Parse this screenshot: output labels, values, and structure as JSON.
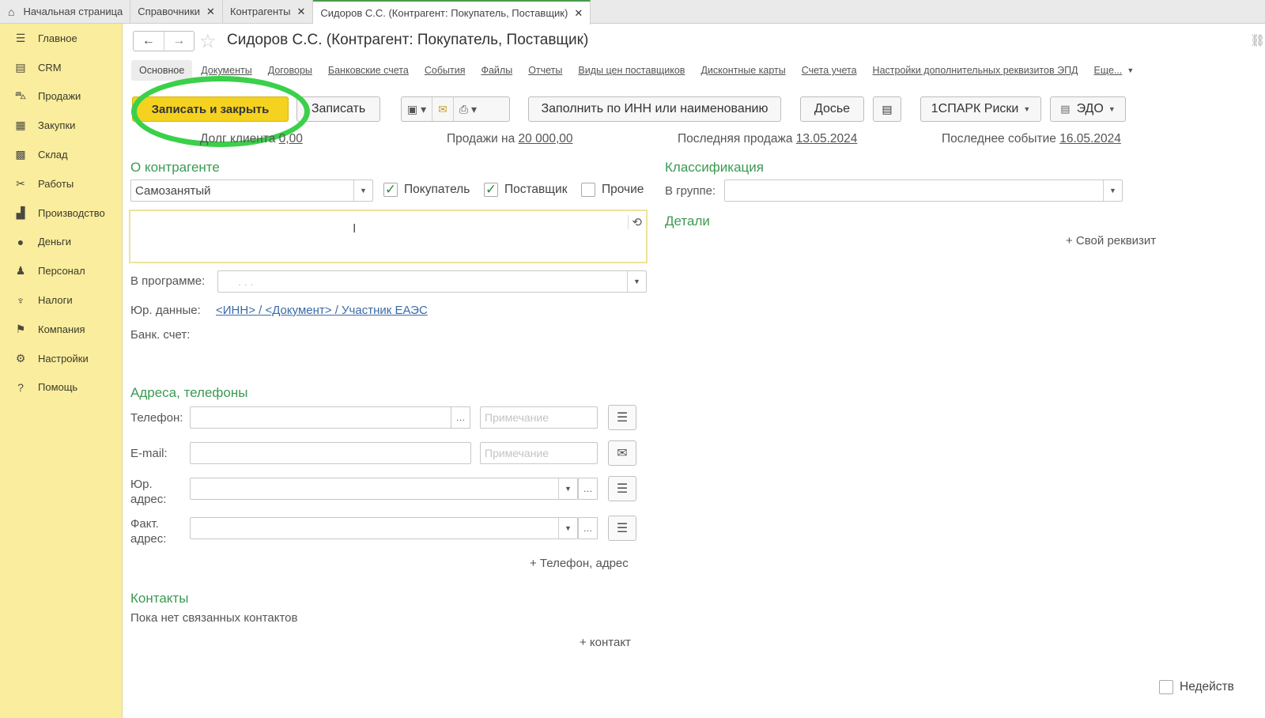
{
  "top_tabs": [
    {
      "label": "Начальная страница",
      "home": true
    },
    {
      "label": "Справочники"
    },
    {
      "label": "Контрагенты"
    },
    {
      "label": "Сидоров С.С. (Контрагент: Покупатель, Поставщик)",
      "active": true
    }
  ],
  "sidebar": {
    "items": [
      {
        "label": "Главное",
        "icon": "menu-icon",
        "glyph": "☰"
      },
      {
        "label": "CRM",
        "icon": "crm-icon",
        "glyph": "▤"
      },
      {
        "label": "Продажи",
        "icon": "sales-icon",
        "glyph": "⛍"
      },
      {
        "label": "Закупки",
        "icon": "purchases-icon",
        "glyph": "▦"
      },
      {
        "label": "Склад",
        "icon": "warehouse-icon",
        "glyph": "▩"
      },
      {
        "label": "Работы",
        "icon": "tools-icon",
        "glyph": "✂"
      },
      {
        "label": "Производство",
        "icon": "factory-icon",
        "glyph": "▟"
      },
      {
        "label": "Деньги",
        "icon": "money-icon",
        "glyph": "●"
      },
      {
        "label": "Персонал",
        "icon": "staff-icon",
        "glyph": "♟"
      },
      {
        "label": "Налоги",
        "icon": "taxes-icon",
        "glyph": "♆"
      },
      {
        "label": "Компания",
        "icon": "flag-icon",
        "glyph": "⚑"
      },
      {
        "label": "Настройки",
        "icon": "gear-icon",
        "glyph": "⚙"
      },
      {
        "label": "Помощь",
        "icon": "help-icon",
        "glyph": "?"
      }
    ]
  },
  "header": {
    "title": "Сидоров С.С. (Контрагент: Покупатель, Поставщик)"
  },
  "form_tabs": {
    "current": "Основное",
    "items": [
      "Документы",
      "Договоры",
      "Банковские счета",
      "События",
      "Файлы",
      "Отчеты",
      "Виды цен поставщиков",
      "Дисконтные карты",
      "Счета учета",
      "Настройки дополнительных реквизитов ЭПД",
      "Еще..."
    ]
  },
  "toolbar": {
    "save_close": "Записать и закрыть",
    "save": "Записать",
    "fill_inn": "Заполнить по ИНН или наименованию",
    "dossier": "Досье",
    "spark": "1СПАРК Риски",
    "edo": "ЭДО"
  },
  "info_strip": {
    "debt_label": "Долг клиента",
    "debt_value": "0,00",
    "sales_label": "Продажи на",
    "sales_value": "20 000,00",
    "last_sale_label": "Последняя продажа",
    "last_sale_value": "13.05.2024",
    "last_event_label": "Последнее событие",
    "last_event_value": "16.05.2024"
  },
  "about": {
    "section_title": "О контрагенте",
    "type_value": "Самозанятый",
    "buyer_label": "Покупатель",
    "buyer_checked": true,
    "supplier_label": "Поставщик",
    "supplier_checked": true,
    "other_label": "Прочие",
    "other_checked": false,
    "program_label": "В программе:",
    "program_value": ". . .",
    "legal_label": "Юр. данные:",
    "legal_link": "<ИНН> / <Документ> / Участник ЕАЭС",
    "bank_label": "Банк. счет:"
  },
  "classification": {
    "section_title": "Классификация",
    "group_label": "В группе:",
    "details_title": "Детали",
    "own_attr": "+ Свой реквизит"
  },
  "contacts_section": {
    "section_title": "Адреса, телефоны",
    "phone_label": "Телефон:",
    "email_label": "E-mail:",
    "legal_addr_label": "Юр. адрес:",
    "fact_addr_label": "Факт. адрес:",
    "note_placeholder": "Примечание",
    "add_phone": "+ Телефон, адрес"
  },
  "people": {
    "section_title": "Контакты",
    "empty_text": "Пока нет связанных контактов",
    "add_contact": "+ контакт"
  },
  "footer": {
    "inactive_label": "Недейств"
  },
  "colors": {
    "sidebar_bg": "#fbed9e",
    "primary_button": "#f5d21f",
    "section_header": "#3b9a52",
    "highlight_ring": "#3bd04a"
  }
}
